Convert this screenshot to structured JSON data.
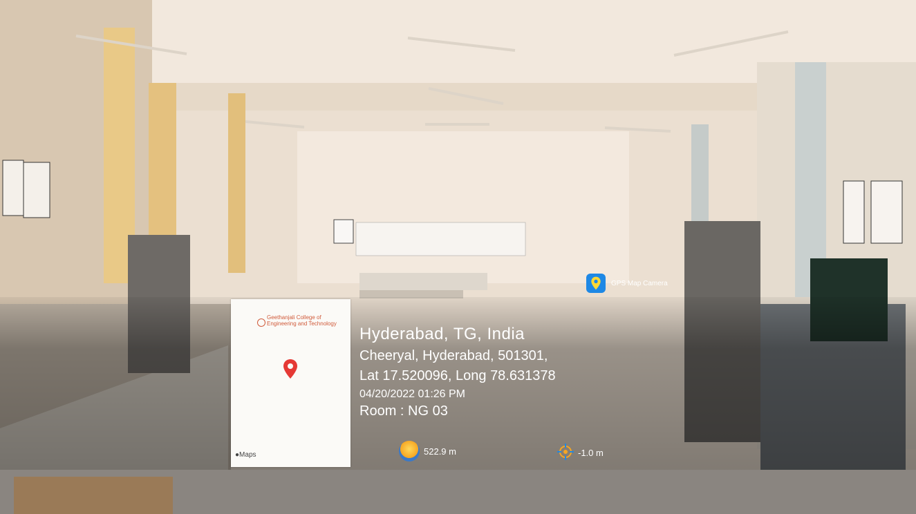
{
  "location": {
    "city": "Hyderabad, TG, India",
    "address": "Cheeryal, Hyderabad, 501301,",
    "coords": "Lat 17.520096, Long 78.631378",
    "datetime": "04/20/2022 01:26 PM",
    "room": "Room : NG 03"
  },
  "map": {
    "college_name": "Geethanjali College of Engineering and Technology",
    "provider": "Maps"
  },
  "app": {
    "name": "GPS Map Camera",
    "icon": "map-pin-icon"
  },
  "metrics": {
    "altitude": "522.9 m",
    "accuracy": "-1.0 m"
  },
  "colors": {
    "pin": "#e53935",
    "gps_icon_bg": "#1e88e5"
  }
}
